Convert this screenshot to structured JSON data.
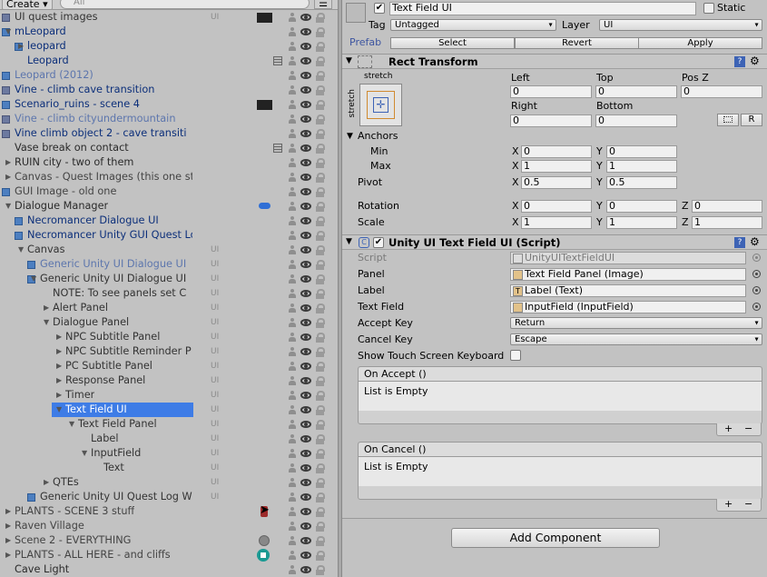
{
  "hierarchy": {
    "create_label": "Create",
    "create_arrow": "▾",
    "search_placeholder": "All",
    "menu_icon_glyph": "☰",
    "rows": [
      {
        "label": "UI quest images",
        "layer": "UI",
        "style": "nested"
      },
      {
        "label": "mLeopard",
        "style": "blue"
      },
      {
        "label": "leopard",
        "style": "blue"
      },
      {
        "label": "Leopard",
        "style": "blue"
      },
      {
        "label": "Leopard (2012)",
        "style": "lightblue"
      },
      {
        "label": "Vine - climb cave transition",
        "style": "blue"
      },
      {
        "label": "Scenario_ruins - scene 4",
        "style": "blue"
      },
      {
        "label": "Vine - climb cityundermountain",
        "style": "lightblue"
      },
      {
        "label": "Vine climb object 2  - cave transiti",
        "style": "blue"
      },
      {
        "label": "Vase break on contact",
        "style": "dark"
      },
      {
        "label": "RUIN city - two of them",
        "style": "dark"
      },
      {
        "label": "Canvas - Quest Images (this one stretches)",
        "style": "grey"
      },
      {
        "label": "GUI Image - old one",
        "style": "grey"
      },
      {
        "label": "Dialogue Manager",
        "style": "dark"
      },
      {
        "label": "Necromancer Dialogue UI",
        "style": "blue"
      },
      {
        "label": "Necromancer Unity GUI Quest Log Windo",
        "style": "blue"
      },
      {
        "label": "Canvas",
        "layer": "UI",
        "style": "nested"
      },
      {
        "label": "Generic Unity UI Dialogue UI",
        "layer": "UI",
        "style": "lightblue"
      },
      {
        "label": "Generic Unity UI Dialogue UI",
        "layer": "UI",
        "style": "nested"
      },
      {
        "label": "NOTE: To see panels set C",
        "layer": "UI",
        "style": "nested"
      },
      {
        "label": "Alert Panel",
        "layer": "UI",
        "style": "nested"
      },
      {
        "label": "Dialogue Panel",
        "layer": "UI",
        "style": "nested"
      },
      {
        "label": "NPC Subtitle Panel",
        "layer": "UI",
        "style": "nested"
      },
      {
        "label": "NPC Subtitle Reminder P",
        "layer": "UI",
        "style": "nested"
      },
      {
        "label": "PC Subtitle Panel",
        "layer": "UI",
        "style": "nested"
      },
      {
        "label": "Response Panel",
        "layer": "UI",
        "style": "nested"
      },
      {
        "label": "Timer",
        "layer": "UI",
        "style": "nested"
      },
      {
        "label": "Text Field UI",
        "layer": "UI",
        "style": "nested"
      },
      {
        "label": "Text Field Panel",
        "layer": "UI",
        "style": "nested"
      },
      {
        "label": "Label",
        "layer": "UI",
        "style": "nested"
      },
      {
        "label": "InputField",
        "layer": "UI",
        "style": "nested"
      },
      {
        "label": "Text",
        "layer": "UI",
        "style": "nested"
      },
      {
        "label": "QTEs",
        "layer": "UI",
        "style": "nested"
      },
      {
        "label": "Generic Unity UI Quest Log W",
        "layer": "UI",
        "style": "nested"
      },
      {
        "label": "PLANTS - SCENE 3 stuff",
        "style": "grey"
      },
      {
        "label": "Raven Village",
        "style": "grey"
      },
      {
        "label": "Scene 2 - EVERYTHING",
        "style": "grey"
      },
      {
        "label": "PLANTS - ALL HERE - and cliffs",
        "style": "grey"
      },
      {
        "label": "Cave Light",
        "style": "dark"
      }
    ]
  },
  "inspector": {
    "object_name": "Text Field UI",
    "static_label": "Static",
    "tag_label": "Tag",
    "tag_value": "Untagged",
    "layer_label": "Layer",
    "layer_value": "UI",
    "prefab_label": "Prefab",
    "prefab_buttons": [
      "Select",
      "Revert",
      "Apply"
    ],
    "rect_transform": {
      "title": "Rect Transform",
      "anchor_preset_label": "stretch",
      "anchor_preset_side_label": "stretch",
      "left_label": "Left",
      "left": "0",
      "top_label": "Top",
      "top": "0",
      "posz_label": "Pos Z",
      "posz": "0",
      "right_label": "Right",
      "right": "0",
      "bottom_label": "Bottom",
      "bottom": "0",
      "r_button": "R",
      "anchors_label": "Anchors",
      "min_label": "Min",
      "min_x": "0",
      "min_y": "0",
      "max_label": "Max",
      "max_x": "1",
      "max_y": "1",
      "pivot_label": "Pivot",
      "pivot_x": "0.5",
      "pivot_y": "0.5",
      "rotation_label": "Rotation",
      "rot_x": "0",
      "rot_y": "0",
      "rot_z": "0",
      "scale_label": "Scale",
      "scale_x": "1",
      "scale_y": "1",
      "scale_z": "1",
      "x_label": "X",
      "y_label": "Y",
      "z_label": "Z"
    },
    "script_component": {
      "title": "Unity UI Text Field UI (Script)",
      "script_label": "Script",
      "script_value": "UnityUITextFieldUI",
      "panel_label": "Panel",
      "panel_value": "Text Field Panel (Image)",
      "label_label": "Label",
      "label_value": "Label (Text)",
      "textfield_label": "Text Field",
      "textfield_value": "InputField (InputField)",
      "accept_key_label": "Accept Key",
      "accept_key_value": "Return",
      "cancel_key_label": "Cancel Key",
      "cancel_key_value": "Escape",
      "show_touch_label": "Show Touch Screen Keyboard",
      "on_accept_title": "On Accept ()",
      "on_accept_body": "List is Empty",
      "on_cancel_title": "On Cancel ()",
      "on_cancel_body": "List is Empty",
      "plus": "+",
      "minus": "−"
    },
    "add_component_label": "Add Component"
  }
}
